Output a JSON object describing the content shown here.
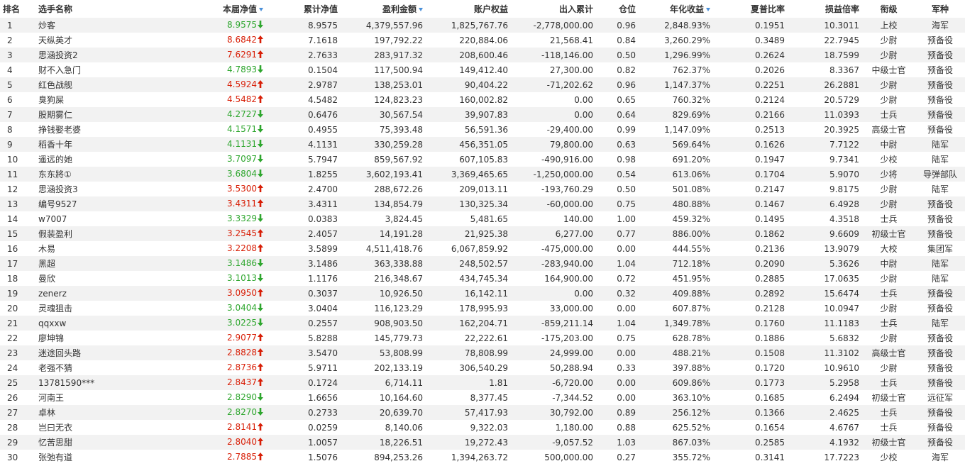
{
  "headers": {
    "rank": "排名",
    "name": "选手名称",
    "nav": "本届净值",
    "cum_nav": "累计净值",
    "profit": "盈利金额",
    "equity": "账户权益",
    "flow": "出入累计",
    "position": "仓位",
    "annual": "年化收益",
    "sharpe": "夏普比率",
    "pl_ratio": "损益倍率",
    "title": "衔级",
    "branch": "军种"
  },
  "colors": {
    "up": "#d81e06",
    "down": "#2ea62e",
    "sort_icon": "#4a90d9",
    "row_alt": "#f2f2f2"
  },
  "icons": {
    "up": "arrow-up-icon",
    "down": "arrow-down-icon",
    "sort": "sort-desc-icon"
  },
  "rows": [
    {
      "rank": "1",
      "name": "炒客",
      "nav": "8.9575",
      "dir": "down",
      "cum_nav": "8.9575",
      "profit": "4,379,557.96",
      "equity": "1,825,767.76",
      "flow": "-2,778,000.00",
      "position": "0.96",
      "annual": "2,848.93%",
      "sharpe": "0.1951",
      "pl_ratio": "10.3011",
      "title": "上校",
      "branch": "海军"
    },
    {
      "rank": "2",
      "name": "天纵英才",
      "nav": "8.6842",
      "dir": "up",
      "cum_nav": "7.1618",
      "profit": "197,792.22",
      "equity": "220,884.06",
      "flow": "21,568.41",
      "position": "0.84",
      "annual": "3,260.29%",
      "sharpe": "0.3489",
      "pl_ratio": "22.7945",
      "title": "少尉",
      "branch": "预备役"
    },
    {
      "rank": "3",
      "name": "思涵投资2",
      "nav": "7.6291",
      "dir": "up",
      "cum_nav": "2.7633",
      "profit": "283,917.32",
      "equity": "208,600.46",
      "flow": "-118,146.00",
      "position": "0.50",
      "annual": "1,296.99%",
      "sharpe": "0.2624",
      "pl_ratio": "18.7599",
      "title": "少尉",
      "branch": "预备役"
    },
    {
      "rank": "4",
      "name": "财不入急门",
      "nav": "4.7893",
      "dir": "down",
      "cum_nav": "0.1504",
      "profit": "117,500.94",
      "equity": "149,412.40",
      "flow": "27,300.00",
      "position": "0.82",
      "annual": "762.37%",
      "sharpe": "0.2026",
      "pl_ratio": "8.3367",
      "title": "中级士官",
      "branch": "预备役"
    },
    {
      "rank": "5",
      "name": "红色战舰",
      "nav": "4.5924",
      "dir": "up",
      "cum_nav": "2.9787",
      "profit": "138,253.01",
      "equity": "90,404.22",
      "flow": "-71,202.62",
      "position": "0.96",
      "annual": "1,147.37%",
      "sharpe": "0.2251",
      "pl_ratio": "26.2881",
      "title": "少尉",
      "branch": "预备役"
    },
    {
      "rank": "6",
      "name": "臭狗屎",
      "nav": "4.5482",
      "dir": "up",
      "cum_nav": "4.5482",
      "profit": "124,823.23",
      "equity": "160,002.82",
      "flow": "0.00",
      "position": "0.65",
      "annual": "760.32%",
      "sharpe": "0.2124",
      "pl_ratio": "20.5729",
      "title": "少尉",
      "branch": "预备役"
    },
    {
      "rank": "7",
      "name": "股期雾仁",
      "nav": "4.2727",
      "dir": "down",
      "cum_nav": "0.6476",
      "profit": "30,567.54",
      "equity": "39,907.83",
      "flow": "0.00",
      "position": "0.64",
      "annual": "829.69%",
      "sharpe": "0.2166",
      "pl_ratio": "11.0393",
      "title": "士兵",
      "branch": "预备役"
    },
    {
      "rank": "8",
      "name": "挣钱娶老婆",
      "nav": "4.1571",
      "dir": "down",
      "cum_nav": "0.4955",
      "profit": "75,393.48",
      "equity": "56,591.36",
      "flow": "-29,400.00",
      "position": "0.99",
      "annual": "1,147.09%",
      "sharpe": "0.2513",
      "pl_ratio": "20.3925",
      "title": "高级士官",
      "branch": "预备役"
    },
    {
      "rank": "9",
      "name": "稻香十年",
      "nav": "4.1131",
      "dir": "down",
      "cum_nav": "4.1131",
      "profit": "330,259.28",
      "equity": "456,351.05",
      "flow": "79,800.00",
      "position": "0.63",
      "annual": "569.64%",
      "sharpe": "0.1626",
      "pl_ratio": "7.7122",
      "title": "中尉",
      "branch": "陆军"
    },
    {
      "rank": "10",
      "name": "遥远的她",
      "nav": "3.7097",
      "dir": "down",
      "cum_nav": "5.7947",
      "profit": "859,567.92",
      "equity": "607,105.83",
      "flow": "-490,916.00",
      "position": "0.98",
      "annual": "691.20%",
      "sharpe": "0.1947",
      "pl_ratio": "9.7341",
      "title": "少校",
      "branch": "陆军"
    },
    {
      "rank": "11",
      "name": "东东將①",
      "nav": "3.6804",
      "dir": "down",
      "cum_nav": "1.8255",
      "profit": "3,602,193.41",
      "equity": "3,369,465.65",
      "flow": "-1,250,000.00",
      "position": "0.54",
      "annual": "613.06%",
      "sharpe": "0.1704",
      "pl_ratio": "5.9070",
      "title": "少将",
      "branch": "导弹部队"
    },
    {
      "rank": "12",
      "name": "思涵投资3",
      "nav": "3.5300",
      "dir": "up",
      "cum_nav": "2.4700",
      "profit": "288,672.26",
      "equity": "209,013.11",
      "flow": "-193,760.29",
      "position": "0.50",
      "annual": "501.08%",
      "sharpe": "0.2147",
      "pl_ratio": "9.8175",
      "title": "少尉",
      "branch": "陆军"
    },
    {
      "rank": "13",
      "name": "编号9527",
      "nav": "3.4311",
      "dir": "up",
      "cum_nav": "3.4311",
      "profit": "134,854.79",
      "equity": "130,325.34",
      "flow": "-60,000.00",
      "position": "0.75",
      "annual": "480.88%",
      "sharpe": "0.1467",
      "pl_ratio": "6.4928",
      "title": "少尉",
      "branch": "预备役"
    },
    {
      "rank": "14",
      "name": "w7007",
      "nav": "3.3329",
      "dir": "down",
      "cum_nav": "0.0383",
      "profit": "3,824.45",
      "equity": "5,481.65",
      "flow": "140.00",
      "position": "1.00",
      "annual": "459.32%",
      "sharpe": "0.1495",
      "pl_ratio": "4.3518",
      "title": "士兵",
      "branch": "预备役"
    },
    {
      "rank": "15",
      "name": "假装盈利",
      "nav": "3.2545",
      "dir": "up",
      "cum_nav": "2.4057",
      "profit": "14,191.28",
      "equity": "21,925.38",
      "flow": "6,277.00",
      "position": "0.77",
      "annual": "886.00%",
      "sharpe": "0.1862",
      "pl_ratio": "9.6609",
      "title": "初级士官",
      "branch": "预备役"
    },
    {
      "rank": "16",
      "name": "木易",
      "nav": "3.2208",
      "dir": "up",
      "cum_nav": "3.5899",
      "profit": "4,511,418.76",
      "equity": "6,067,859.92",
      "flow": "-475,000.00",
      "position": "0.00",
      "annual": "444.55%",
      "sharpe": "0.2136",
      "pl_ratio": "13.9079",
      "title": "大校",
      "branch": "集团军"
    },
    {
      "rank": "17",
      "name": "黑超",
      "nav": "3.1486",
      "dir": "down",
      "cum_nav": "3.1486",
      "profit": "363,338.88",
      "equity": "248,502.57",
      "flow": "-283,940.00",
      "position": "1.04",
      "annual": "712.18%",
      "sharpe": "0.2090",
      "pl_ratio": "5.3626",
      "title": "中尉",
      "branch": "陆军"
    },
    {
      "rank": "18",
      "name": "曼欣",
      "nav": "3.1013",
      "dir": "down",
      "cum_nav": "1.1176",
      "profit": "216,348.67",
      "equity": "434,745.34",
      "flow": "164,900.00",
      "position": "0.72",
      "annual": "451.95%",
      "sharpe": "0.2885",
      "pl_ratio": "17.0635",
      "title": "少尉",
      "branch": "陆军"
    },
    {
      "rank": "19",
      "name": "zenerz",
      "nav": "3.0950",
      "dir": "up",
      "cum_nav": "0.3037",
      "profit": "10,926.50",
      "equity": "16,142.11",
      "flow": "0.00",
      "position": "0.32",
      "annual": "409.88%",
      "sharpe": "0.2892",
      "pl_ratio": "15.6474",
      "title": "士兵",
      "branch": "预备役"
    },
    {
      "rank": "20",
      "name": "灵魂狙击",
      "nav": "3.0404",
      "dir": "down",
      "cum_nav": "3.0404",
      "profit": "116,123.29",
      "equity": "178,995.93",
      "flow": "33,000.00",
      "position": "0.00",
      "annual": "607.87%",
      "sharpe": "0.2128",
      "pl_ratio": "10.0947",
      "title": "少尉",
      "branch": "预备役"
    },
    {
      "rank": "21",
      "name": "qqxxw",
      "nav": "3.0225",
      "dir": "down",
      "cum_nav": "0.2557",
      "profit": "908,903.50",
      "equity": "162,204.71",
      "flow": "-859,211.14",
      "position": "1.04",
      "annual": "1,349.78%",
      "sharpe": "0.1760",
      "pl_ratio": "11.1183",
      "title": "士兵",
      "branch": "陆军"
    },
    {
      "rank": "22",
      "name": "廖坤锦",
      "nav": "2.9077",
      "dir": "up",
      "cum_nav": "5.8288",
      "profit": "145,779.73",
      "equity": "22,222.61",
      "flow": "-175,203.00",
      "position": "0.75",
      "annual": "628.78%",
      "sharpe": "0.1886",
      "pl_ratio": "5.6832",
      "title": "少尉",
      "branch": "预备役"
    },
    {
      "rank": "23",
      "name": "迷途回头路",
      "nav": "2.8828",
      "dir": "up",
      "cum_nav": "3.5470",
      "profit": "53,808.99",
      "equity": "78,808.99",
      "flow": "24,999.00",
      "position": "0.00",
      "annual": "488.21%",
      "sharpe": "0.1508",
      "pl_ratio": "11.3102",
      "title": "高级士官",
      "branch": "预备役"
    },
    {
      "rank": "24",
      "name": "老强不猜",
      "nav": "2.8736",
      "dir": "up",
      "cum_nav": "5.9711",
      "profit": "202,133.19",
      "equity": "306,540.29",
      "flow": "50,288.94",
      "position": "0.33",
      "annual": "397.88%",
      "sharpe": "0.1720",
      "pl_ratio": "10.9610",
      "title": "少尉",
      "branch": "预备役"
    },
    {
      "rank": "25",
      "name": "13781590***",
      "nav": "2.8437",
      "dir": "up",
      "cum_nav": "0.1724",
      "profit": "6,714.11",
      "equity": "1.81",
      "flow": "-6,720.00",
      "position": "0.00",
      "annual": "609.86%",
      "sharpe": "0.1773",
      "pl_ratio": "5.2958",
      "title": "士兵",
      "branch": "预备役"
    },
    {
      "rank": "26",
      "name": "河南王",
      "nav": "2.8290",
      "dir": "down",
      "cum_nav": "1.6656",
      "profit": "10,164.60",
      "equity": "8,377.45",
      "flow": "-7,344.52",
      "position": "0.00",
      "annual": "363.10%",
      "sharpe": "0.1685",
      "pl_ratio": "6.2494",
      "title": "初级士官",
      "branch": "远征军"
    },
    {
      "rank": "27",
      "name": "卓林",
      "nav": "2.8270",
      "dir": "down",
      "cum_nav": "0.2733",
      "profit": "20,639.70",
      "equity": "57,417.93",
      "flow": "30,792.00",
      "position": "0.89",
      "annual": "256.12%",
      "sharpe": "0.1366",
      "pl_ratio": "2.4625",
      "title": "士兵",
      "branch": "预备役"
    },
    {
      "rank": "28",
      "name": "岂曰无衣",
      "nav": "2.8141",
      "dir": "up",
      "cum_nav": "0.0259",
      "profit": "8,140.06",
      "equity": "9,322.03",
      "flow": "1,180.00",
      "position": "0.88",
      "annual": "625.52%",
      "sharpe": "0.1654",
      "pl_ratio": "4.6767",
      "title": "士兵",
      "branch": "预备役"
    },
    {
      "rank": "29",
      "name": "忆苦思甜",
      "nav": "2.8040",
      "dir": "up",
      "cum_nav": "1.0057",
      "profit": "18,226.51",
      "equity": "19,272.43",
      "flow": "-9,057.52",
      "position": "1.03",
      "annual": "867.03%",
      "sharpe": "0.2585",
      "pl_ratio": "4.1932",
      "title": "初级士官",
      "branch": "预备役"
    },
    {
      "rank": "30",
      "name": "张弛有道",
      "nav": "2.7885",
      "dir": "up",
      "cum_nav": "1.5076",
      "profit": "894,253.26",
      "equity": "1,394,263.72",
      "flow": "500,000.00",
      "position": "0.27",
      "annual": "355.72%",
      "sharpe": "0.3141",
      "pl_ratio": "17.7223",
      "title": "少校",
      "branch": "海军"
    }
  ]
}
